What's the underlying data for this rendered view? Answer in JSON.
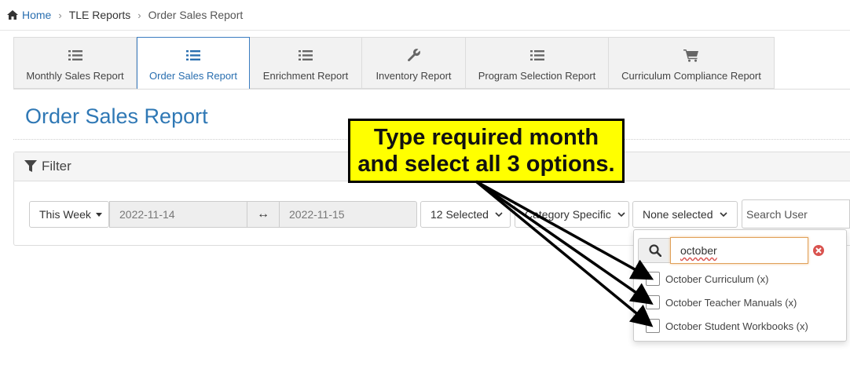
{
  "breadcrumb": {
    "items": [
      "Home",
      "TLE Reports",
      "Order Sales Report"
    ],
    "separator": "›"
  },
  "tabs": [
    {
      "label": "Monthly Sales Report",
      "icon": "list-icon",
      "active": false
    },
    {
      "label": "Order Sales Report",
      "icon": "list-icon",
      "active": true
    },
    {
      "label": "Enrichment Report",
      "icon": "list-icon",
      "active": false
    },
    {
      "label": "Inventory Report",
      "icon": "wrench-icon",
      "active": false
    },
    {
      "label": "Program Selection Report",
      "icon": "list-icon",
      "active": false
    },
    {
      "label": "Curriculum Compliance Report",
      "icon": "cart-icon",
      "active": false
    }
  ],
  "page_title": "Order Sales Report",
  "filter": {
    "heading": "Filter",
    "range_select": "This Week",
    "date_from": "2022-11-14",
    "range_separator": "↔",
    "date_to": "2022-11-15",
    "multi_select_1": "12 Selected",
    "category_select": "Category Specific",
    "multi_select_2": "None selected",
    "user_search_placeholder": "Search User"
  },
  "dropdown": {
    "search_value": "october",
    "options": [
      {
        "label": "October Curriculum (x)",
        "checked": false
      },
      {
        "label": "October Teacher Manuals (x)",
        "checked": false
      },
      {
        "label": "October Student Workbooks (x)",
        "checked": false
      }
    ]
  },
  "callout": {
    "line1": "Type required month",
    "line2": "and select all 3 options."
  },
  "colors": {
    "accent": "#2f78b5",
    "callout_bg": "#ffff00",
    "focus_border": "#e0a15a",
    "clear_icon": "#d9534f"
  }
}
